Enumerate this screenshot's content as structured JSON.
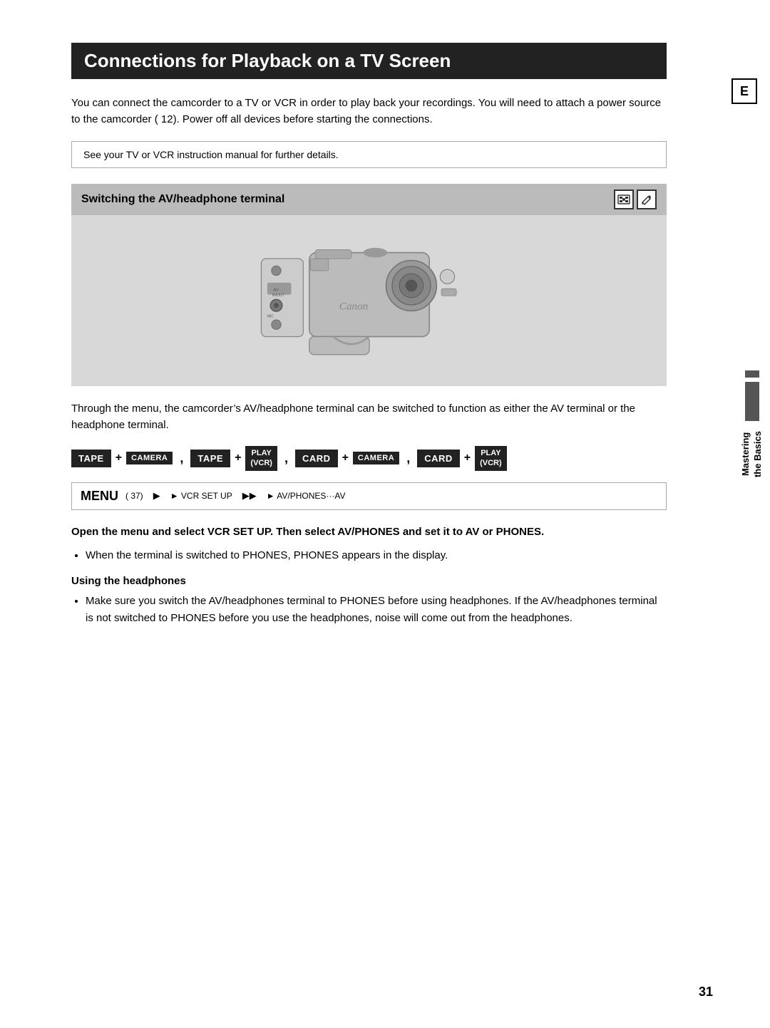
{
  "page": {
    "title": "Connections for Playback on a TV Screen",
    "intro": "You can connect the camcorder to a TV or VCR in order to play back your recordings. You will need to attach a power source to the camcorder ( 12). Power off all devices before starting the connections.",
    "note": "See your TV or VCR instruction manual for further details.",
    "section_title": "Switching the AV/headphone terminal",
    "description": "Through the menu, the camcorder’s AV/headphone terminal can be switched to function as either the AV terminal or the headphone terminal.",
    "button_row": {
      "tape1": "TAPE",
      "camera1": "CAMERA",
      "tape2": "TAPE",
      "play_vcr1_line1": "PLAY",
      "play_vcr1_line2": "(VCR)",
      "card1": "CARD",
      "camera2": "CAMERA",
      "card2": "CARD",
      "play_vcr2_line1": "PLAY",
      "play_vcr2_line2": "(VCR)"
    },
    "menu_box": {
      "menu_word": "MENU",
      "ref": "( 37)",
      "vcr_set_up": "► VCR SET UP",
      "av_phones": "► AV/PHONES···AV"
    },
    "instruction_bold": "Open the menu and select VCR SET UP. Then select AV/PHONES and set it to AV or PHONES.",
    "bullet1": "When the terminal is switched to PHONES, PHONES appears in the display.",
    "sub_heading": "Using the headphones",
    "bullet2": "Make sure you switch the AV/headphones terminal to PHONES before using headphones. If the AV/headphones terminal is not switched to PHONES before you use the headphones, noise will come out from the headphones.",
    "sidebar_letter": "E",
    "mastering_line1": "Mastering",
    "mastering_line2": "the Basics",
    "page_number": "31"
  }
}
